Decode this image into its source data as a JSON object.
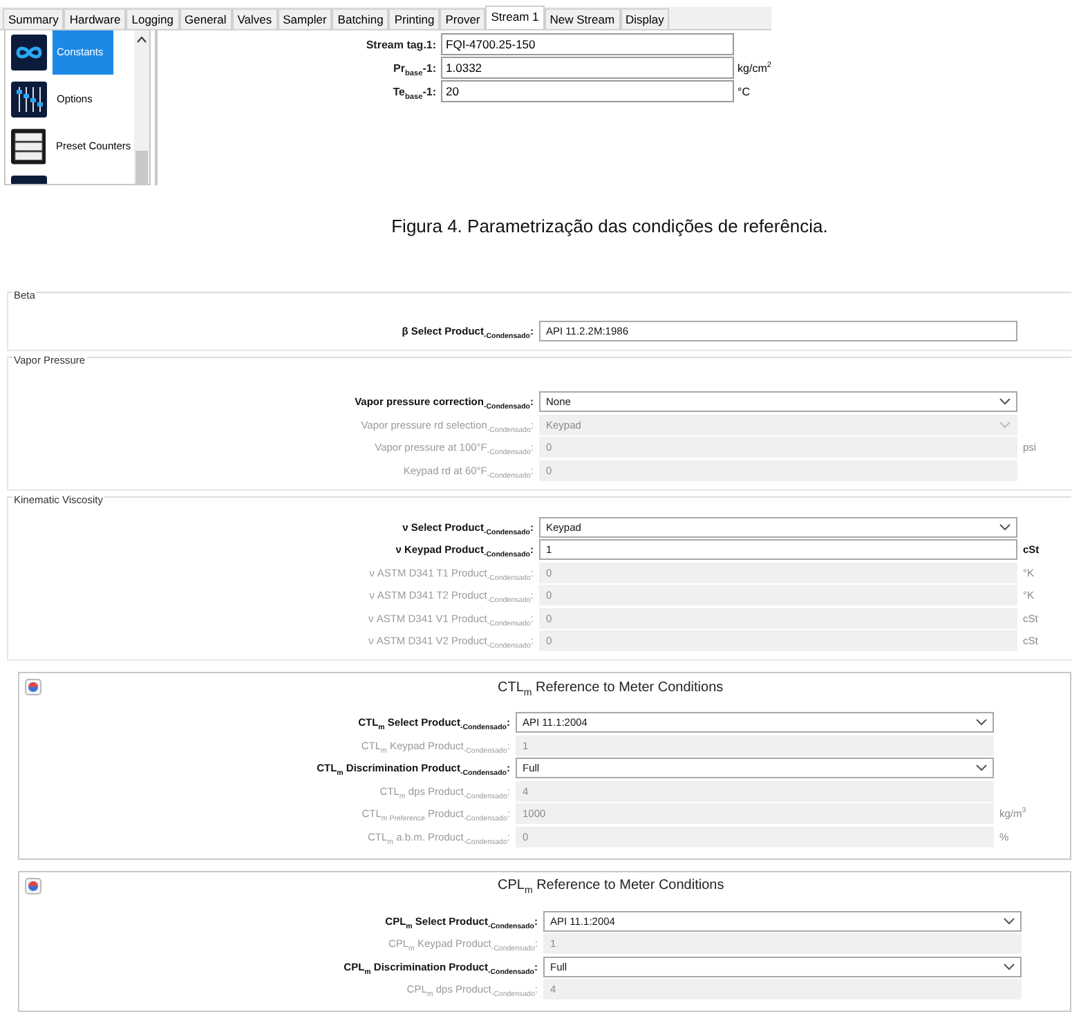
{
  "top_window": {
    "tabs": [
      {
        "label": "Summary",
        "selected": false
      },
      {
        "label": "Hardware",
        "selected": false
      },
      {
        "label": "Logging",
        "selected": false
      },
      {
        "label": "General",
        "selected": false
      },
      {
        "label": "Valves",
        "selected": false
      },
      {
        "label": "Sampler",
        "selected": false
      },
      {
        "label": "Batching",
        "selected": false
      },
      {
        "label": "Printing",
        "selected": false
      },
      {
        "label": "Prover",
        "selected": false
      },
      {
        "label": "Stream 1",
        "selected": true
      },
      {
        "label": "New Stream",
        "selected": false
      },
      {
        "label": "Display",
        "selected": false
      }
    ],
    "sidebar": {
      "items": [
        {
          "kind": "infinity",
          "label": "Constants",
          "selected": true
        },
        {
          "kind": "sliders",
          "label": "Options",
          "selected": false
        },
        {
          "kind": "counters",
          "label": "Preset Counters",
          "selected": false
        },
        {
          "kind": "tile",
          "selected": false
        }
      ]
    },
    "fields": [
      {
        "label": "Stream tag.1:",
        "value": "FQI-4700.25-150"
      },
      {
        "label": "Pr$_{base}$-1:",
        "value": "1.0332",
        "unit": "kg/cm$^{2}$"
      },
      {
        "label": "Te$_{base}$-1:",
        "value": "20",
        "unit": "°C"
      }
    ]
  },
  "caption": "Figura 4. Parametrização das condições de referência.",
  "bottom_window": {
    "groups": [
      {
        "title": "Beta",
        "rows": [
          {
            "kind": "text",
            "label": "β Select Product$_{-Condensado}$:",
            "value": "API 11.2.2M:1986",
            "disabled": false
          }
        ]
      },
      {
        "title": "Vapor Pressure",
        "rows": [
          {
            "kind": "select",
            "label": "Vapor pressure correction$_{-Condensado}$:",
            "value": "None",
            "disabled": false
          },
          {
            "kind": "select",
            "label": "Vapor pressure rd selection$_{-Condensado}$:",
            "value": "Keypad",
            "disabled": true
          },
          {
            "kind": "text",
            "label": "Vapor pressure at 100°F$_{-Condensado}$:",
            "value": "0",
            "unit": "psi",
            "disabled": true
          },
          {
            "kind": "text",
            "label": "Keypad rd at 60°F$_{-Condensado}$:",
            "value": "0",
            "disabled": true
          }
        ]
      },
      {
        "title": "Kinematic Viscosity",
        "rows": [
          {
            "kind": "select",
            "label": "ν Select Product$_{-Condensado}$:",
            "value": "Keypad",
            "disabled": false
          },
          {
            "kind": "text",
            "label": "ν Keypad Product$_{-Condensado}$:",
            "value": "1",
            "unit": "cSt",
            "disabled": false
          },
          {
            "kind": "text",
            "label": "ν ASTM D341 T1 Product$_{-Condensado}$:",
            "value": "0",
            "unit": "°K",
            "disabled": true
          },
          {
            "kind": "text",
            "label": "ν ASTM D341 T2 Product$_{-Condensado}$:",
            "value": "0",
            "unit": "°K",
            "disabled": true
          },
          {
            "kind": "text",
            "label": "ν ASTM D341 V1 Product$_{-Condensado}$:",
            "value": "0",
            "unit": "cSt",
            "disabled": true
          },
          {
            "kind": "text",
            "label": "ν ASTM D341 V2 Product$_{-Condensado}$:",
            "value": "0",
            "unit": "cSt",
            "disabled": true
          }
        ]
      }
    ],
    "panels": [
      {
        "title": "CTL$_{m}$ Reference to Meter Conditions",
        "rows": [
          {
            "kind": "select",
            "label": "CTL$_{m}$ Select Product$_{-Condensado}$:",
            "value": "API 11.1:2004",
            "disabled": false
          },
          {
            "kind": "text",
            "label": "CTL$_{m}$ Keypad Product$_{-Condensado}$:",
            "value": "1",
            "disabled": true
          },
          {
            "kind": "select",
            "label": "CTL$_{m}$ Discrimination Product$_{-Condensado}$:",
            "value": "Full",
            "disabled": false
          },
          {
            "kind": "text",
            "label": "CTL$_{m}$ dps Product$_{-Condensado}$:",
            "value": "4",
            "disabled": true
          },
          {
            "kind": "text",
            "label": "CTL$_{m Preference}$ Product$_{-Condensado}$:",
            "value": "1000",
            "unit": "kg/m$^{3}$",
            "disabled": true
          },
          {
            "kind": "text",
            "label": "CTL$_{m}$ a.b.m. Product$_{-Condensado}$:",
            "value": "0",
            "unit": "%",
            "disabled": true
          }
        ]
      },
      {
        "title": "CPL$_{m}$ Reference to Meter Conditions",
        "rows": [
          {
            "kind": "select",
            "label": "CPL$_{m}$ Select Product$_{-Condensado}$:",
            "value": "API 11.1:2004",
            "disabled": false
          },
          {
            "kind": "text",
            "label": "CPL$_{m}$ Keypad Product$_{-Condensado}$:",
            "value": "1",
            "disabled": true
          },
          {
            "kind": "select",
            "label": "CPL$_{m}$ Discrimination Product$_{-Condensado}$:",
            "value": "Full",
            "disabled": false
          },
          {
            "kind": "text",
            "label": "CPL$_{m}$ dps Product$_{-Condensado}$:",
            "value": "4",
            "disabled": true
          }
        ]
      }
    ]
  }
}
